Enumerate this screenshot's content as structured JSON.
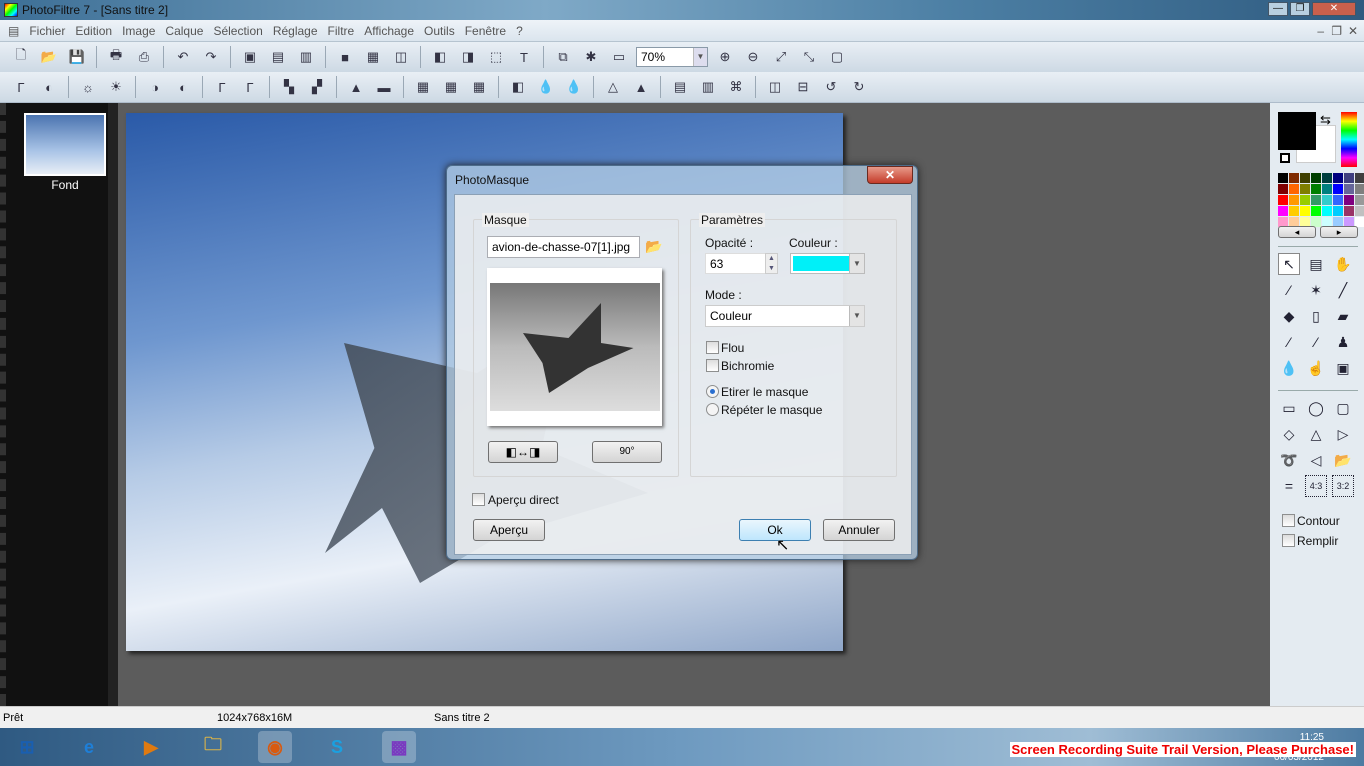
{
  "window": {
    "title": "PhotoFiltre 7 - [Sans titre 2]",
    "controls": [
      "—",
      "❐",
      "✕"
    ]
  },
  "menu": [
    "Fichier",
    "Edition",
    "Image",
    "Calque",
    "Sélection",
    "Réglage",
    "Filtre",
    "Affichage",
    "Outils",
    "Fenêtre",
    "?"
  ],
  "toolbar1": {
    "icons": [
      [
        "new-icon",
        "🗋"
      ],
      [
        "open-icon",
        "📂"
      ],
      [
        "save-icon",
        "💾"
      ],
      [
        "sep"
      ],
      [
        "print-icon",
        "🖶"
      ],
      [
        "scan-icon",
        "⎙"
      ],
      [
        "sep"
      ],
      [
        "undo-icon",
        "↶"
      ],
      [
        "redo-icon",
        "↷"
      ],
      [
        "sep"
      ],
      [
        "paste-layer-icon",
        "▣"
      ],
      [
        "paste-new-icon",
        "▤"
      ],
      [
        "duplicate-icon",
        "▥"
      ],
      [
        "sep"
      ],
      [
        "gradient-icon",
        "■"
      ],
      [
        "colors-icon",
        "▦"
      ],
      [
        "transparency-icon",
        "◫"
      ],
      [
        "sep"
      ],
      [
        "image-size-icon",
        "◧"
      ],
      [
        "canvas-size-icon",
        "◨"
      ],
      [
        "crop-selection-icon",
        "⬚"
      ],
      [
        "text-icon",
        "T"
      ],
      [
        "sep"
      ],
      [
        "explorer-icon",
        "⧉"
      ],
      [
        "plugin-icon",
        "✱"
      ],
      [
        "batch-icon",
        "▭"
      ]
    ],
    "zoom": "70%",
    "icons2": [
      [
        "zoom-in-icon",
        "⊕"
      ],
      [
        "zoom-out-icon",
        "⊖"
      ],
      [
        "fit-icon",
        "⤢"
      ],
      [
        "actual-size-icon",
        "⤡"
      ],
      [
        "fullscreen-icon",
        "▢"
      ]
    ]
  },
  "toolbar2": {
    "icons": [
      [
        "auto-levels-icon",
        "Γ"
      ],
      [
        "auto-contrast-icon",
        "◐"
      ],
      [
        "sep"
      ],
      [
        "brightness-minus-icon",
        "☼"
      ],
      [
        "brightness-plus-icon",
        "☀"
      ],
      [
        "sep"
      ],
      [
        "contrast-minus-icon",
        "◑"
      ],
      [
        "contrast-plus-icon",
        "◐"
      ],
      [
        "sep"
      ],
      [
        "gamma-minus-icon",
        "Γ"
      ],
      [
        "gamma-plus-icon",
        "Γ"
      ],
      [
        "sep"
      ],
      [
        "saturation-minus-icon",
        "▚"
      ],
      [
        "saturation-plus-icon",
        "▞"
      ],
      [
        "sep"
      ],
      [
        "histogram-icon",
        "▲"
      ],
      [
        "rgb-icon",
        "▬"
      ],
      [
        "sep"
      ],
      [
        "grid-gray-icon",
        "▦"
      ],
      [
        "grid-brown-icon",
        "▦"
      ],
      [
        "grid-tan-icon",
        "▦"
      ],
      [
        "sep"
      ],
      [
        "soften-icon",
        "◧"
      ],
      [
        "blur-icon",
        "💧"
      ],
      [
        "blur-more-icon",
        "💧"
      ],
      [
        "sep"
      ],
      [
        "sharpen-icon",
        "△"
      ],
      [
        "sharpen-more-icon",
        "▲"
      ],
      [
        "sep"
      ],
      [
        "rainbow-icon",
        "▤"
      ],
      [
        "gradient-fill-icon",
        "▥"
      ],
      [
        "transform-icon",
        "⌘"
      ],
      [
        "sep"
      ],
      [
        "flip-h-icon",
        "◫"
      ],
      [
        "flip-v-icon",
        "⊟"
      ],
      [
        "rotate-left-icon",
        "↺"
      ],
      [
        "rotate-right-icon",
        "↻"
      ]
    ]
  },
  "filmstrip": {
    "layer_label": "Fond"
  },
  "status": {
    "state": "Prêt",
    "size": "1024x768x16M",
    "doc": "Sans titre 2"
  },
  "taskbar": {
    "items": [
      [
        "start-icon",
        "⊞",
        "#1a5fb0"
      ],
      [
        "ie-icon",
        "e",
        "#1e7fd8"
      ],
      [
        "media-player-icon",
        "▶",
        "#e07a10"
      ],
      [
        "explorer-icon",
        "🗀",
        "#d8b24a"
      ],
      [
        "firefox-icon",
        "◉",
        "#d85a10"
      ],
      [
        "skype-icon",
        "S",
        "#1aa0e0"
      ],
      [
        "photofiltre-icon",
        "▩",
        "#7a3ac0"
      ]
    ],
    "clock": "11:25",
    "date": "06/03/2012",
    "watermark": "Screen Recording Suite Trail Version, Please Purchase!"
  },
  "palette": {
    "foreground": "#000000",
    "background": "#ffffff",
    "swatches": [
      "#000000",
      "#7f2a00",
      "#3f3f00",
      "#003f00",
      "#003f3f",
      "#00007f",
      "#3f3f7f",
      "#3f3f3f",
      "#7f0000",
      "#ff6600",
      "#7f7f00",
      "#007f00",
      "#007f7f",
      "#0000ff",
      "#66669a",
      "#7f7f7f",
      "#ff0000",
      "#ff9900",
      "#99cc00",
      "#339966",
      "#33cccc",
      "#3366ff",
      "#800080",
      "#999999",
      "#ff00ff",
      "#ffcc00",
      "#ffff00",
      "#00ff00",
      "#00ffff",
      "#00ccff",
      "#993366",
      "#c0c0c0",
      "#ff99cc",
      "#ffcc99",
      "#ffff99",
      "#ccffcc",
      "#ccffff",
      "#99ccff",
      "#cc99ff",
      "#ffffff"
    ],
    "prev": "◂",
    "next": "▸"
  },
  "tools": [
    [
      "select-arrow-icon",
      "↖"
    ],
    [
      "layer-manager-icon",
      "▤"
    ],
    [
      "hand-icon",
      "✋"
    ],
    [
      "eyedropper-icon",
      "⁄"
    ],
    [
      "magic-wand-icon",
      "✶"
    ],
    [
      "line-icon",
      "╱"
    ],
    [
      "fill-bucket-icon",
      "◆"
    ],
    [
      "spray-icon",
      "▯"
    ],
    [
      "eraser-icon",
      "▰"
    ],
    [
      "brush-icon",
      "⁄"
    ],
    [
      "brush-plus-icon",
      "⁄"
    ],
    [
      "stamp-icon",
      "♟"
    ],
    [
      "blur-drop-icon",
      "💧"
    ],
    [
      "finger-smudge-icon",
      "☝"
    ],
    [
      "mona-lisa-icon",
      "▣"
    ]
  ],
  "shapes": [
    [
      "rectangle-icon",
      "▭"
    ],
    [
      "ellipse-icon",
      "◯"
    ],
    [
      "rounded-rect-icon",
      "▢"
    ],
    [
      "diamond-icon",
      "◇"
    ],
    [
      "triangle-icon",
      "△"
    ],
    [
      "triangle-right-icon",
      "▷"
    ],
    [
      "lasso-icon",
      "➰"
    ],
    [
      "polygon-lasso-icon",
      "◁"
    ],
    [
      "open-shape-icon",
      "📂"
    ],
    [
      "ratio-free-icon",
      "="
    ],
    [
      "ratio-43-icon",
      "4:3"
    ],
    [
      "ratio-32-icon",
      "3:2"
    ]
  ],
  "shape_options": {
    "contour": "Contour",
    "fill": "Remplir"
  },
  "dialog": {
    "title": "PhotoMasque",
    "close": "✕",
    "mask_group": "Masque",
    "mask_file": "avion-de-chasse-07[1].jpg",
    "params_group": "Paramètres",
    "opacity_label": "Opacité :",
    "opacity_value": "63",
    "color_label": "Couleur :",
    "color_value": "#00f0f8",
    "mode_label": "Mode :",
    "mode_value": "Couleur",
    "blur": "Flou",
    "bichromie": "Bichromie",
    "stretch": "Etirer le masque",
    "repeat": "Répéter le masque",
    "mode_option_selected": "stretch",
    "live_preview": "Aperçu direct",
    "preview_btn": "Aperçu",
    "ok_btn": "Ok",
    "cancel_btn": "Annuler",
    "invert_btn": "◧↔◨",
    "rotate_btn": "90°"
  }
}
